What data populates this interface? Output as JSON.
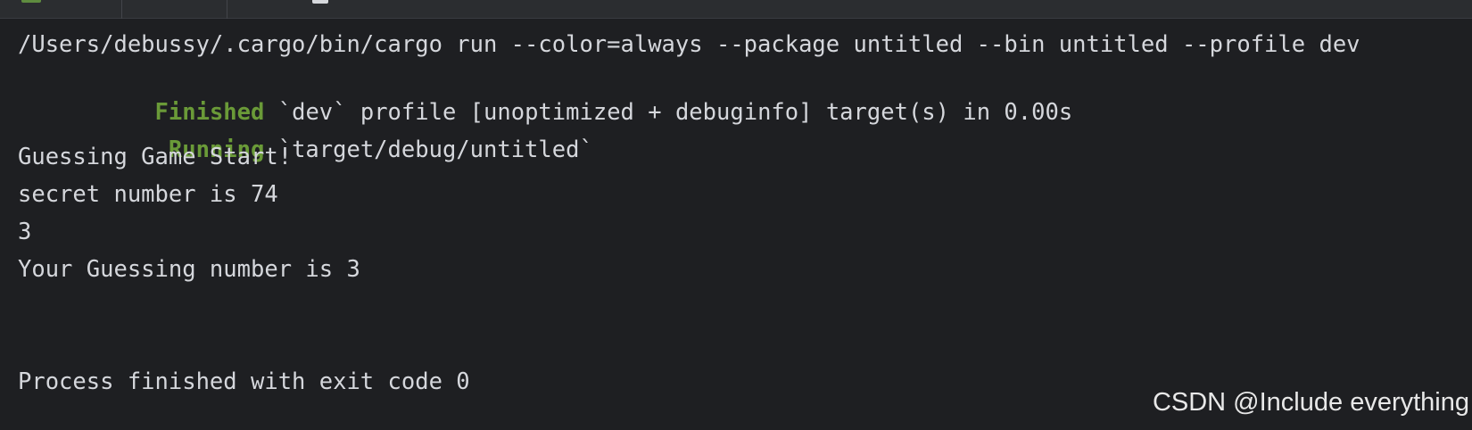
{
  "colors": {
    "background": "#1e1f22",
    "text": "#d5d7dc",
    "status_green": "#6a9a38",
    "watermark": "#e8e8e8"
  },
  "console": {
    "command": "/Users/debussy/.cargo/bin/cargo run --color=always --package untitled --bin untitled --profile dev",
    "finished_status": "Finished",
    "finished_message": "`dev` profile [unoptimized + debuginfo] target(s) in 0.00s",
    "running_status": "Running",
    "running_message": "`target/debug/untitled`",
    "output_lines": [
      "Guessing Game Start!",
      "secret number is 74",
      "3",
      "Your Guessing number is 3"
    ],
    "process_exit": "Process finished with exit code 0"
  },
  "watermark": "CSDN @Include everything"
}
